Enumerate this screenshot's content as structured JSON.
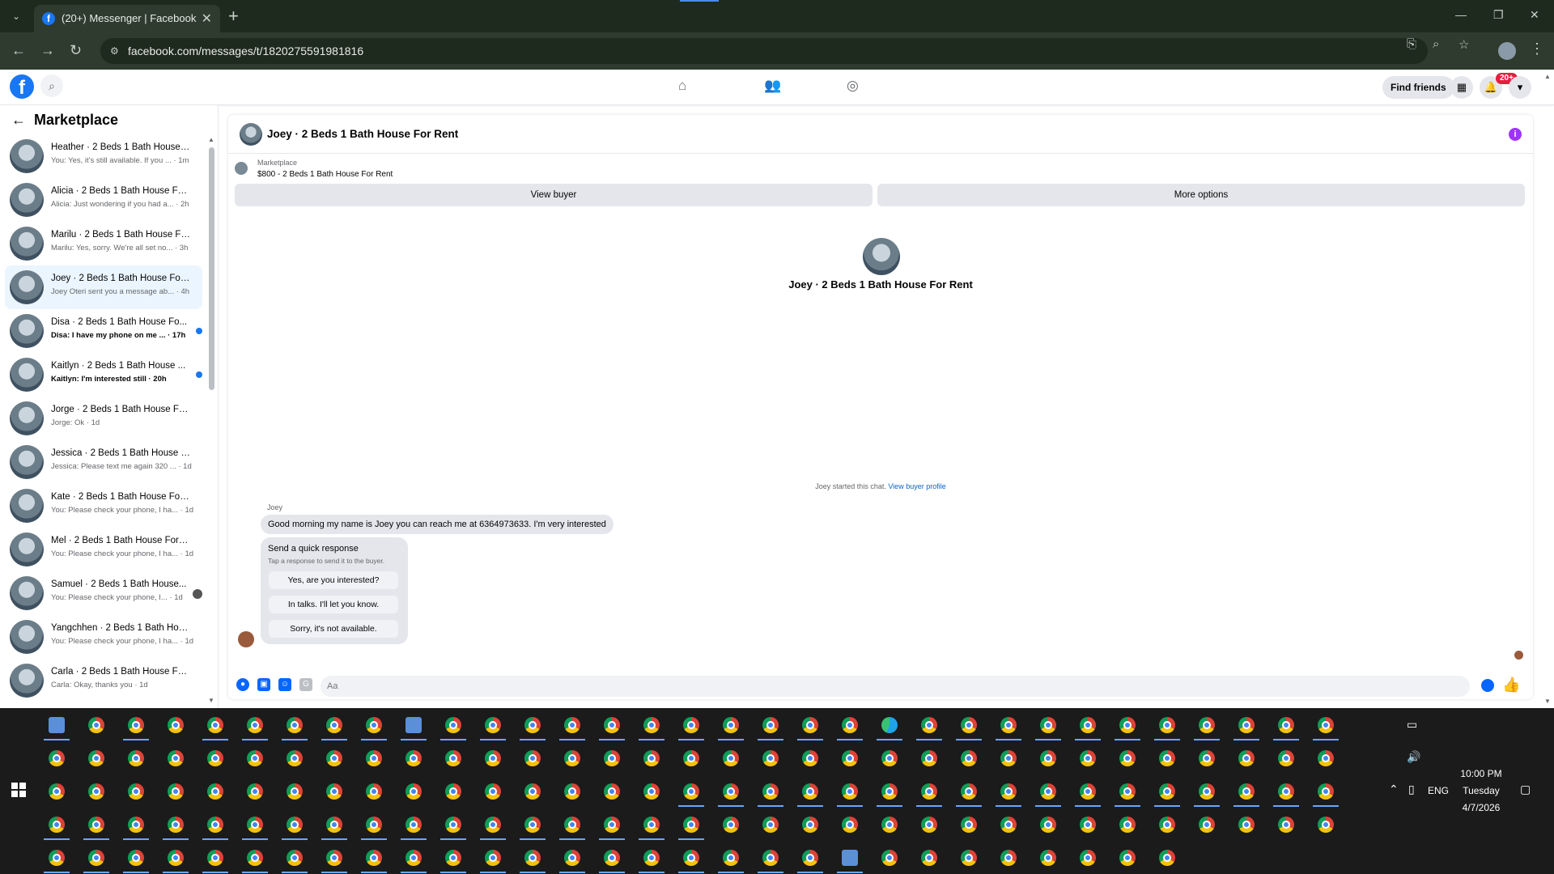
{
  "browser": {
    "tab_title": "(20+) Messenger | Facebook",
    "url": "facebook.com/messages/t/1820275591981816"
  },
  "fb_header": {
    "logo": "f",
    "find_friends": "Find friends",
    "notif_badge": "20+"
  },
  "sidebar": {
    "title": "Marketplace",
    "conversations": [
      {
        "name": "Heather · 2 Beds 1 Bath House F...",
        "preview": "You: Yes, it's still available. If you ... · 1m",
        "state": "read"
      },
      {
        "name": "Alicia · 2 Beds 1 Bath House For...",
        "preview": "Alicia: Just wondering if you had a... · 2h",
        "state": "read"
      },
      {
        "name": "Marilu · 2 Beds 1 Bath House Fo...",
        "preview": "Marilu: Yes, sorry. We're all set no... · 3h",
        "state": "read"
      },
      {
        "name": "Joey · 2 Beds 1 Bath House For ...",
        "preview": "Joey Oteri sent you a message ab... · 4h",
        "state": "active"
      },
      {
        "name": "Disa · 2 Beds 1 Bath House Fo...",
        "preview": "Disa: I have my phone on me ... · 17h",
        "state": "unread"
      },
      {
        "name": "Kaitlyn · 2 Beds 1 Bath House ...",
        "preview": "Kaitlyn: I'm interested still · 20h",
        "state": "unread"
      },
      {
        "name": "Jorge · 2 Beds 1 Bath House For...",
        "preview": "Jorge: Ok · 1d",
        "state": "read"
      },
      {
        "name": "Jessica · 2 Beds 1 Bath House Fo...",
        "preview": "Jessica: Please text me again 320 ... · 1d",
        "state": "read"
      },
      {
        "name": "Kate · 2 Beds 1 Bath House For ...",
        "preview": "You: Please check your phone, I ha... · 1d",
        "state": "read"
      },
      {
        "name": "Mel · 2 Beds 1 Bath House For R...",
        "preview": "You: Please check your phone, I ha... · 1d",
        "state": "read"
      },
      {
        "name": "Samuel · 2 Beds 1 Bath House...",
        "preview": "You: Please check your phone, I... · 1d",
        "state": "seen"
      },
      {
        "name": "Yangchhen · 2 Beds 1 Bath Hous...",
        "preview": "You: Please check your phone, I ha... · 1d",
        "state": "read"
      },
      {
        "name": "Carla · 2 Beds 1 Bath House For ...",
        "preview": "Carla: Okay, thanks you · 1d",
        "state": "read"
      }
    ]
  },
  "chat": {
    "title": "Joey · 2 Beds 1 Bath House For Rent",
    "listing_kind": "Marketplace",
    "listing_price": "$800 - 2 Beds 1 Bath House For Rent",
    "view_buyer": "View buyer",
    "more_options": "More options",
    "center_title": "Joey · 2 Beds 1 Bath House For Rent",
    "started_text": "Joey started this chat.",
    "view_buyer_profile": "View buyer profile",
    "sender": "Joey",
    "message": "Good morning my name is Joey you can reach me at 6364973633. I'm very interested",
    "quick_title": "Send a quick response",
    "quick_sub": "Tap a response to send it to the buyer.",
    "quick_responses": [
      "Yes, are you interested?",
      "In talks. I'll let you know.",
      "Sorry, it's not available."
    ],
    "composer_placeholder": "Aa"
  },
  "taskbar": {
    "time": "10:00 PM",
    "day": "Tuesday",
    "date": "4/7/2026",
    "language": "ENG"
  },
  "colors": {
    "facebook_blue": "#1877f2",
    "messenger_blue": "#0866ff",
    "active_conv": "#ebf5ff",
    "unread_dot": "#1877f2",
    "info_purple": "#a033ff"
  }
}
